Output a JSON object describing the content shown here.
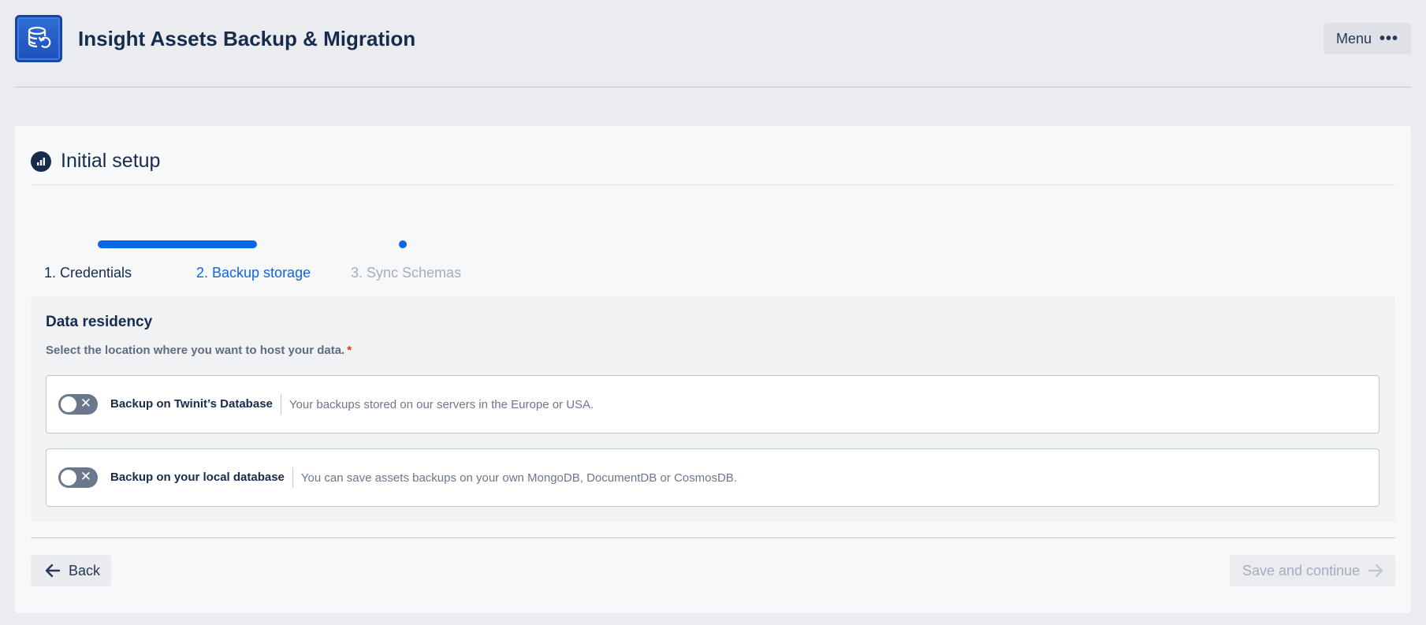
{
  "header": {
    "title": "Insight Assets Backup & Migration",
    "menu_label": "Menu",
    "menu_dots": "•••"
  },
  "card": {
    "title": "Initial setup"
  },
  "stepper": {
    "steps": [
      {
        "label": "1. Credentials",
        "state": "completed"
      },
      {
        "label": "2. Backup storage",
        "state": "active"
      },
      {
        "label": "3. Sync Schemas",
        "state": "upcoming"
      }
    ]
  },
  "data_residency": {
    "title": "Data residency",
    "subtitle": "Select the location where you want to host your data.",
    "required_mark": "*",
    "options": [
      {
        "label": "Backup on Twinit’s Database",
        "description": "Your backups stored on our servers in the Europe or USA.",
        "enabled": false,
        "toggle_glyph": "✕"
      },
      {
        "label": "Backup on your local database",
        "description": "You can save assets backups on your own MongoDB, DocumentDB or CosmosDB.",
        "enabled": false,
        "toggle_glyph": "✕"
      }
    ]
  },
  "footer": {
    "back_label": "Back",
    "save_label": "Save and continue"
  },
  "colors": {
    "accent": "#0c66e4",
    "required": "#de350b",
    "toggle_off": "#6b778c"
  }
}
